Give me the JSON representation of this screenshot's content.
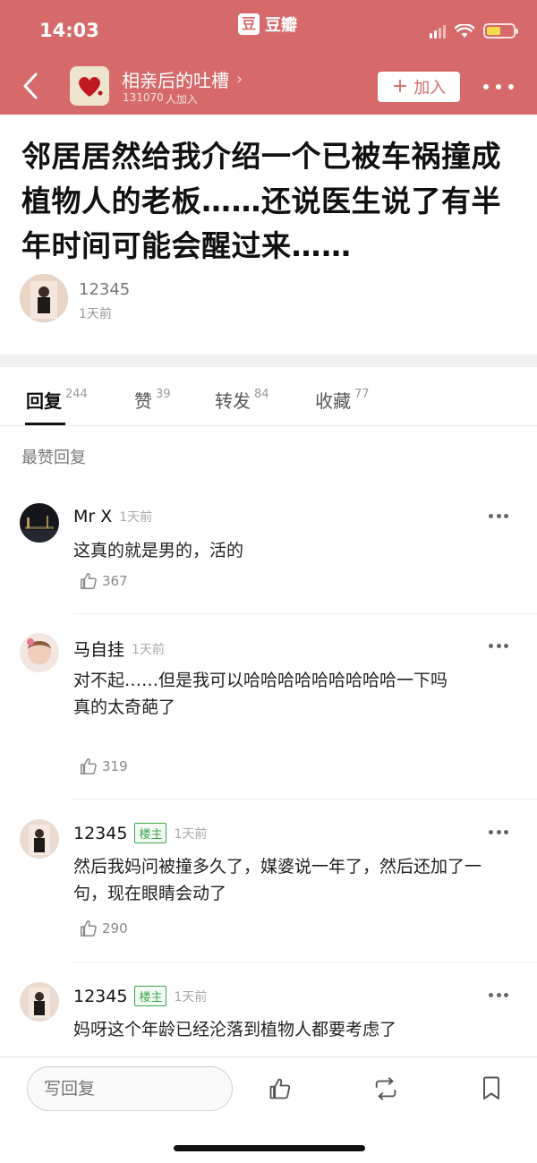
{
  "status_bar": {
    "time": "14:03",
    "app_name": "豆瓣",
    "app_logo_char": "豆"
  },
  "header": {
    "back_icon": "chevron-left-icon",
    "group_name": "相亲后的吐槽",
    "group_chevron": "›",
    "member_count": "131070",
    "member_suffix": "人加入",
    "join_plus": "+",
    "join_label": "加入",
    "accent_color": "#d66a6a"
  },
  "post": {
    "title": "邻居居然给我介绍一个已被车祸撞成植物人的老板……还说医生说了有半年时间可能会醒过来……",
    "author": "12345",
    "time": "1天前"
  },
  "tabs": [
    {
      "label": "回复",
      "count": "244",
      "active": true
    },
    {
      "label": "赞",
      "count": "39",
      "active": false
    },
    {
      "label": "转发",
      "count": "84",
      "active": false
    },
    {
      "label": "收藏",
      "count": "77",
      "active": false
    }
  ],
  "section_label": "最赞回复",
  "comments": [
    {
      "name": "Mr X",
      "badge": "",
      "time": "1天前",
      "text": "这真的就是男的，活的",
      "likes": "367"
    },
    {
      "name": "马自挂",
      "badge": "",
      "time": "1天前",
      "text": "对不起……但是我可以哈哈哈哈哈哈哈哈哈一下吗\n真的太奇葩了",
      "likes": "319"
    },
    {
      "name": "12345",
      "badge": "楼主",
      "time": "1天前",
      "text": "然后我妈问被撞多久了，媒婆说一年了，然后还加了一句，现在眼睛会动了",
      "likes": "290"
    },
    {
      "name": "12345",
      "badge": "楼主",
      "time": "1天前",
      "text": "妈呀这个年龄已经沦落到植物人都要考虑了",
      "likes": ""
    }
  ],
  "bottom_bar": {
    "reply_placeholder": "写回复",
    "icons": [
      "thumbs-up-icon",
      "repost-icon",
      "bookmark-icon"
    ]
  }
}
